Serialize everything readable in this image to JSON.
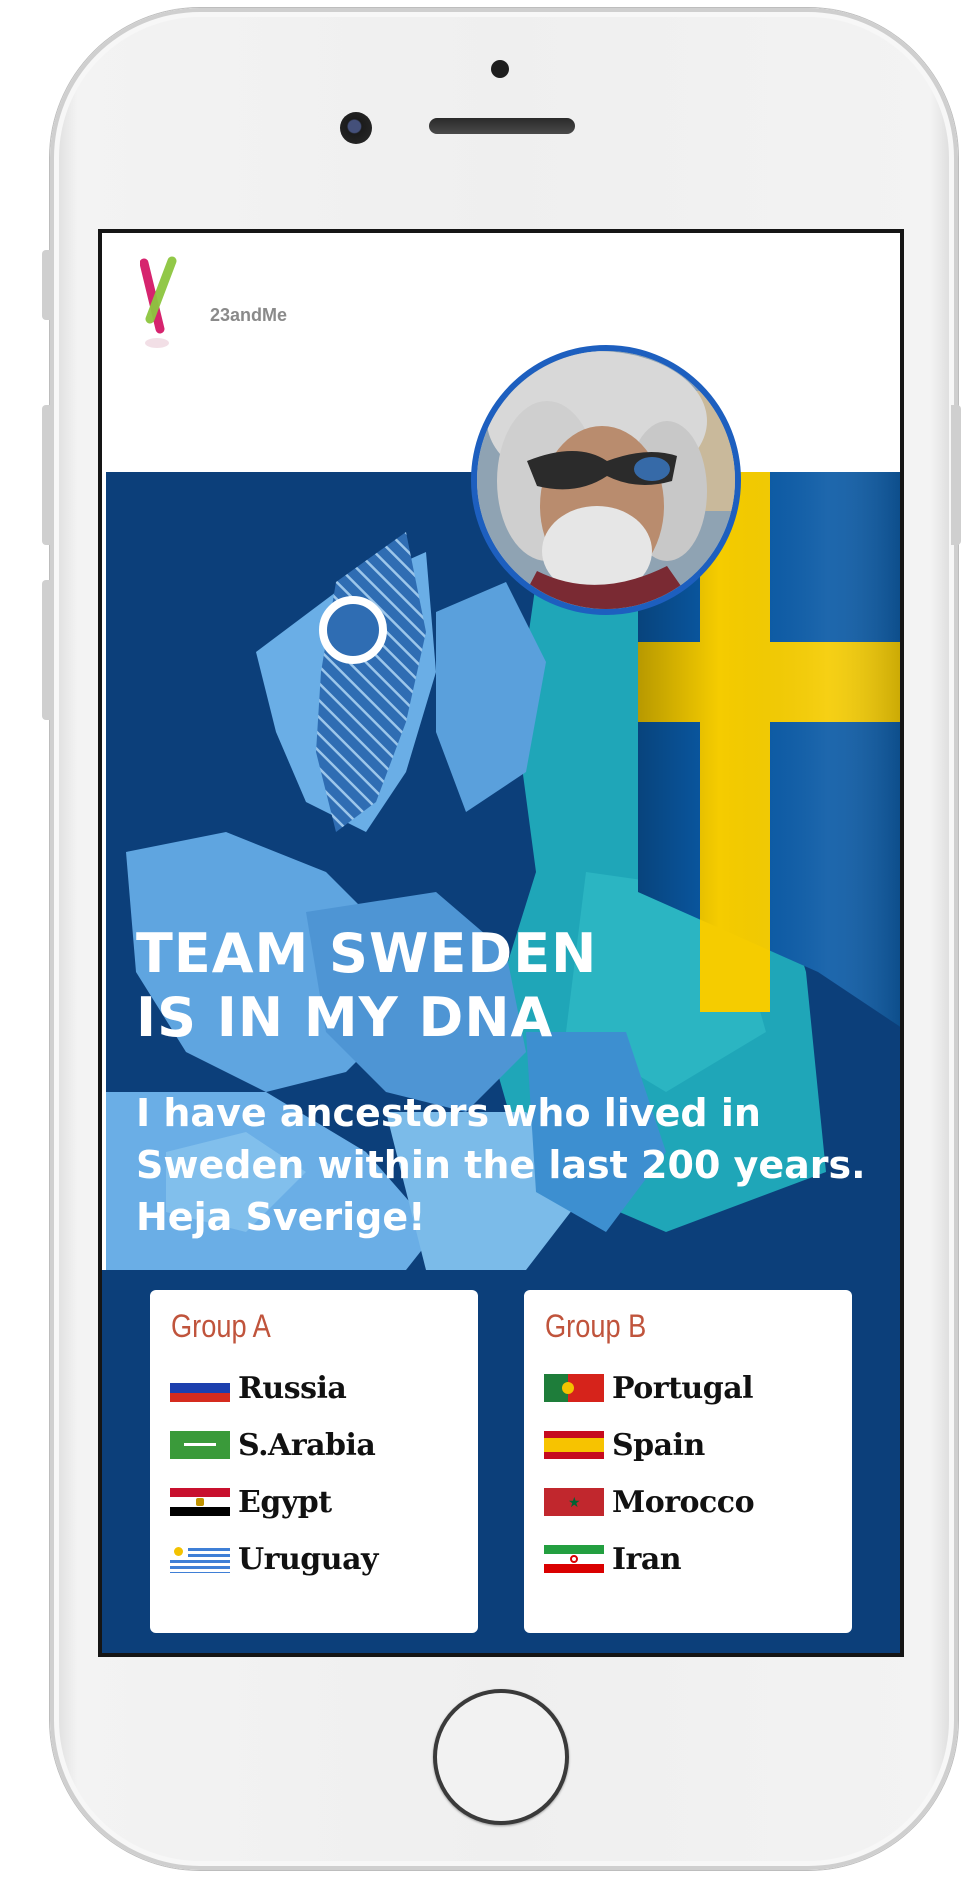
{
  "brand": {
    "logo_text": "23andMe"
  },
  "hero": {
    "title_line1": "TEAM SWEDEN",
    "title_line2": "IS IN MY DNA",
    "subtitle_line1": "I have ancestors who lived in",
    "subtitle_line2": "Sweden within the last 200 years.",
    "subtitle_line3": "Heja Sverige!"
  },
  "groups": [
    {
      "title": "Group A",
      "teams": [
        {
          "name": "Russia",
          "flag": "russia-flag"
        },
        {
          "name": "S.Arabia",
          "flag": "saudi-arabia-flag"
        },
        {
          "name": "Egypt",
          "flag": "egypt-flag"
        },
        {
          "name": "Uruguay",
          "flag": "uruguay-flag"
        }
      ]
    },
    {
      "title": "Group B",
      "teams": [
        {
          "name": "Portugal",
          "flag": "portugal-flag"
        },
        {
          "name": "Spain",
          "flag": "spain-flag"
        },
        {
          "name": "Morocco",
          "flag": "morocco-flag"
        },
        {
          "name": "Iran",
          "flag": "iran-flag"
        }
      ]
    }
  ],
  "colors": {
    "hero_blue": "#0c3f7a",
    "avatar_ring": "#1d5fbf",
    "group_title": "#c0543c",
    "sweden_yellow": "#f5cc00",
    "sweden_blue": "#0a5aa6"
  }
}
